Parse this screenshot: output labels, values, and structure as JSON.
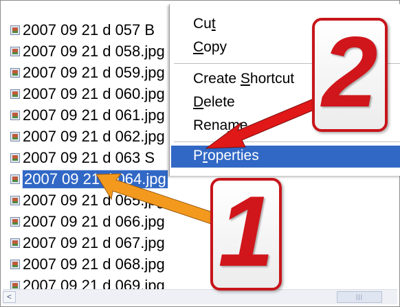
{
  "files": [
    {
      "name": "2007 09 21 d 057 B"
    },
    {
      "name": "2007 09 21 d 058.jpg"
    },
    {
      "name": "2007 09 21 d 059.jpg"
    },
    {
      "name": "2007 09 21 d 060.jpg"
    },
    {
      "name": "2007 09 21 d 061.jpg"
    },
    {
      "name": "2007 09 21 d 062.jpg"
    },
    {
      "name": "2007 09 21 d 063 S"
    },
    {
      "name": "2007 09 21 d 064.jpg"
    },
    {
      "name": "2007 09 21 d 065.jpg"
    },
    {
      "name": "2007 09 21 d 066.jpg"
    },
    {
      "name": "2007 09 21 d 067.jpg"
    },
    {
      "name": "2007 09 21 d 068.jpg"
    },
    {
      "name": "2007 09 21 d 069.jpg"
    }
  ],
  "selected_file_index": 7,
  "context_menu": {
    "cut": {
      "pre": "Cu",
      "key": "t",
      "post": ""
    },
    "copy": {
      "pre": "",
      "key": "C",
      "post": "opy"
    },
    "create_shortcut": {
      "pre": "Create ",
      "key": "S",
      "post": "hortcut"
    },
    "delete": {
      "pre": "",
      "key": "D",
      "post": "elete"
    },
    "rename": {
      "pre": "Rena",
      "key": "m",
      "post": "e"
    },
    "properties": {
      "pre": "P",
      "key": "r",
      "post": "operties"
    }
  },
  "callouts": {
    "step1": "1",
    "step2": "2"
  },
  "scrollbar": {
    "left_arrow": "<",
    "grip": "|||"
  },
  "colors": {
    "selection": "#3168c5",
    "callout_border": "#c7151a",
    "arrow_red": "#e01818",
    "arrow_orange": "#f39a1e"
  },
  "icons": {
    "file": "image-file-icon",
    "arrow_left": "scroll-left-arrow-icon"
  }
}
